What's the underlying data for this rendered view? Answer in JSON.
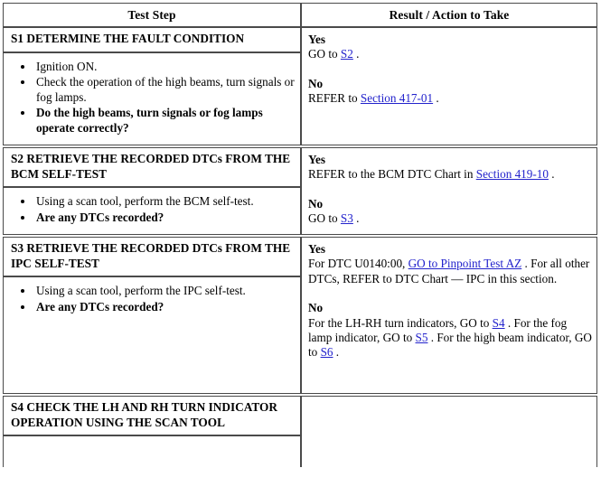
{
  "document": {
    "type": "diagnostic-pinpoint-test-table"
  },
  "table": {
    "headers": {
      "test_step": "Test Step",
      "result_action": "Result / Action to Take"
    },
    "steps": [
      {
        "id": "S1",
        "title": "S1 DETERMINE THE FAULT CONDITION",
        "bullets": [
          {
            "text": "Ignition ON.",
            "bold": false
          },
          {
            "text": "Check the operation of the high beams, turn signals or fog lamps.",
            "bold": false
          },
          {
            "text": "Do the high beams, turn signals or fog lamps operate correctly?",
            "bold": true
          }
        ],
        "result": {
          "yes_label": "Yes",
          "yes_pre": "GO to ",
          "yes_link": "S2",
          "yes_post": " .",
          "no_label": "No",
          "no_pre": "REFER to ",
          "no_link": "Section 417-01",
          "no_post": " ."
        }
      },
      {
        "id": "S2",
        "title": "S2 RETRIEVE THE RECORDED DTCs FROM THE BCM SELF-TEST",
        "bullets": [
          {
            "text": "Using a scan tool, perform the BCM self-test.",
            "bold": false
          },
          {
            "text": "Are any DTCs recorded?",
            "bold": true
          }
        ],
        "result": {
          "yes_label": "Yes",
          "yes_pre": "REFER to the BCM DTC Chart in ",
          "yes_link": "Section 419-10",
          "yes_post": " .",
          "no_label": "No",
          "no_pre": "GO to ",
          "no_link": "S3",
          "no_post": " ."
        }
      },
      {
        "id": "S3",
        "title": "S3 RETRIEVE THE RECORDED DTCs FROM THE IPC SELF-TEST",
        "bullets": [
          {
            "text": "Using a scan tool, perform the IPC self-test.",
            "bold": false
          },
          {
            "text": "Are any DTCs recorded?",
            "bold": true
          }
        ],
        "result": {
          "yes_label": "Yes",
          "yes_pre": "For DTC U0140:00, ",
          "yes_link": "GO to Pinpoint Test AZ",
          "yes_post": " . For all other DTCs, REFER to DTC Chart — IPC in this section.",
          "no_label": "No",
          "no_seg1": "For the LH-RH turn indicators, GO to ",
          "no_link1": "S4",
          "no_seg2": " . For the fog lamp indicator, GO to ",
          "no_link2": "S5",
          "no_seg3": " . For the high beam indicator, GO to ",
          "no_link3": "S6",
          "no_seg4": " ."
        }
      },
      {
        "id": "S4",
        "title": "S4 CHECK THE LH AND RH TURN INDICATOR OPERATION USING THE SCAN TOOL",
        "bullets": [],
        "result": {}
      }
    ]
  },
  "colors": {
    "link": "#2222cc",
    "border": "#4a4a4a",
    "text": "#000000",
    "background": "#ffffff"
  }
}
